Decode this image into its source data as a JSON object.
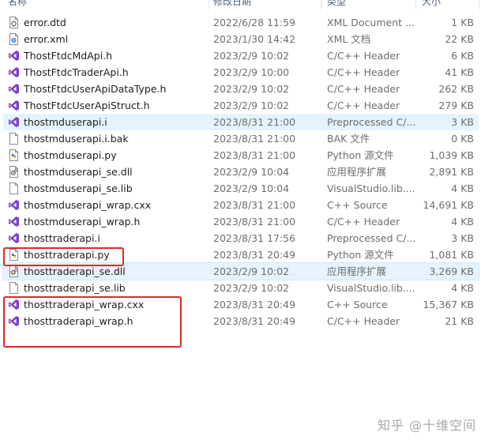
{
  "header": {
    "name": "名称",
    "date": "修改日期",
    "type": "类型",
    "size": "大小"
  },
  "files": [
    {
      "name": "error.dtd",
      "date": "2022/6/28 11:59",
      "type": "XML Document ...",
      "size": "1 KB",
      "icon": "dtd-file-icon"
    },
    {
      "name": "error.xml",
      "date": "2023/1/30 14:42",
      "type": "XML 文档",
      "size": "22 KB",
      "icon": "xml-file-icon"
    },
    {
      "name": "ThostFtdcMdApi.h",
      "date": "2023/2/9 10:02",
      "type": "C/C++ Header",
      "size": "6 KB",
      "icon": "visual-studio-icon"
    },
    {
      "name": "ThostFtdcTraderApi.h",
      "date": "2023/2/9 10:00",
      "type": "C/C++ Header",
      "size": "41 KB",
      "icon": "visual-studio-icon"
    },
    {
      "name": "ThostFtdcUserApiDataType.h",
      "date": "2023/2/9 10:02",
      "type": "C/C++ Header",
      "size": "262 KB",
      "icon": "visual-studio-icon"
    },
    {
      "name": "ThostFtdcUserApiStruct.h",
      "date": "2023/2/9 10:02",
      "type": "C/C++ Header",
      "size": "279 KB",
      "icon": "visual-studio-icon"
    },
    {
      "name": "thostmduserapi.i",
      "date": "2023/8/31 21:00",
      "type": "Preprocessed C/...",
      "size": "3 KB",
      "icon": "visual-studio-icon"
    },
    {
      "name": "thostmduserapi.i.bak",
      "date": "2023/8/31 21:00",
      "type": "BAK 文件",
      "size": "0 KB",
      "icon": "blank-file-icon"
    },
    {
      "name": "thostmduserapi.py",
      "date": "2023/8/31 21:00",
      "type": "Python 源文件",
      "size": "1,039 KB",
      "icon": "python-file-icon"
    },
    {
      "name": "thostmduserapi_se.dll",
      "date": "2023/2/9 10:04",
      "type": "应用程序扩展",
      "size": "2,891 KB",
      "icon": "dll-file-icon"
    },
    {
      "name": "thostmduserapi_se.lib",
      "date": "2023/2/9 10:04",
      "type": "VisualStudio.lib....",
      "size": "4 KB",
      "icon": "blank-file-icon"
    },
    {
      "name": "thostmduserapi_wrap.cxx",
      "date": "2023/8/31 21:00",
      "type": "C++ Source",
      "size": "14,691 KB",
      "icon": "visual-studio-icon"
    },
    {
      "name": "thostmduserapi_wrap.h",
      "date": "2023/8/31 21:00",
      "type": "C/C++ Header",
      "size": "4 KB",
      "icon": "visual-studio-icon"
    },
    {
      "name": "thosttraderapi.i",
      "date": "2023/8/31 17:56",
      "type": "Preprocessed C/...",
      "size": "3 KB",
      "icon": "visual-studio-icon"
    },
    {
      "name": "thosttraderapi.py",
      "date": "2023/8/31 20:49",
      "type": "Python 源文件",
      "size": "1,081 KB",
      "icon": "python-file-icon"
    },
    {
      "name": "thosttraderapi_se.dll",
      "date": "2023/2/9 10:02",
      "type": "应用程序扩展",
      "size": "3,269 KB",
      "icon": "dll-file-icon"
    },
    {
      "name": "thosttraderapi_se.lib",
      "date": "2023/2/9 10:02",
      "type": "VisualStudio.lib....",
      "size": "4 KB",
      "icon": "blank-file-icon"
    },
    {
      "name": "thosttraderapi_wrap.cxx",
      "date": "2023/8/31 20:49",
      "type": "C++ Source",
      "size": "15,367 KB",
      "icon": "visual-studio-icon"
    },
    {
      "name": "thosttraderapi_wrap.h",
      "date": "2023/8/31 20:49",
      "type": "C/C++ Header",
      "size": "21 KB",
      "icon": "visual-studio-icon"
    }
  ],
  "selected_row": "thostmduserapi.i",
  "hovered_row": "thosttraderapi_se.dll",
  "highlight_color": "#e0282a",
  "watermark": "知乎 @十维空间"
}
